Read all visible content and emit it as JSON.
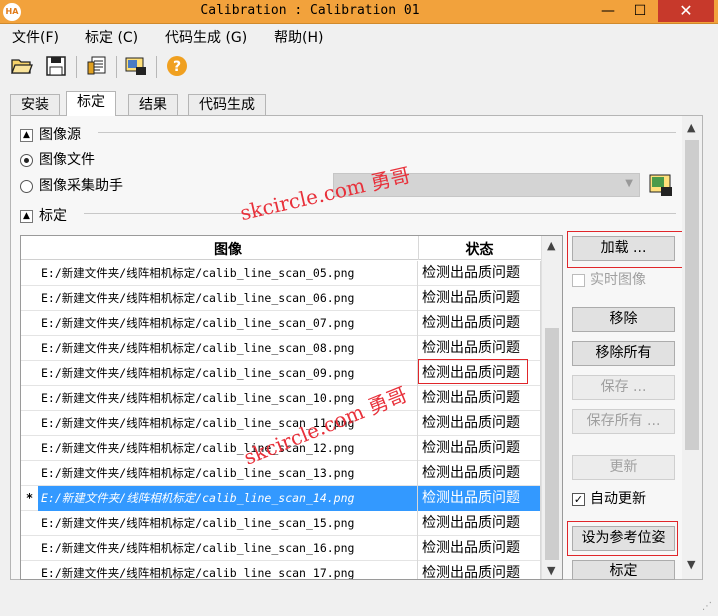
{
  "window": {
    "app_icon_text": "HA",
    "title": "Calibration : Calibration 01",
    "minimize": "—",
    "maximize": "☐",
    "close": "✕"
  },
  "menu": [
    "文件(F)",
    "标定 (C)",
    "代码生成 (G)",
    "帮助(H)"
  ],
  "toolbar": {
    "icons": [
      "open-folder-icon",
      "save-icon",
      "settings-list-icon",
      "camera-capture-icon",
      "help-icon"
    ]
  },
  "tabs": [
    {
      "label": "安装",
      "active": false
    },
    {
      "label": "标定",
      "active": true
    },
    {
      "label": "结果",
      "active": false
    },
    {
      "label": "代码生成",
      "active": false
    }
  ],
  "image_source": {
    "header": "图像源",
    "option_file": "图像文件",
    "option_assistant": "图像采集助手",
    "selected": "图像文件",
    "assistant_combo_value": ""
  },
  "calibration": {
    "header": "标定",
    "columns": [
      "图像",
      "状态"
    ],
    "rows": [
      {
        "marker": "",
        "file": "E:/新建文件夹/线阵相机标定/calib_line_scan_05.png",
        "status": "检测出品质问题"
      },
      {
        "marker": "",
        "file": "E:/新建文件夹/线阵相机标定/calib_line_scan_06.png",
        "status": "检测出品质问题"
      },
      {
        "marker": "",
        "file": "E:/新建文件夹/线阵相机标定/calib_line_scan_07.png",
        "status": "检测出品质问题"
      },
      {
        "marker": "",
        "file": "E:/新建文件夹/线阵相机标定/calib_line_scan_08.png",
        "status": "检测出品质问题"
      },
      {
        "marker": "",
        "file": "E:/新建文件夹/线阵相机标定/calib_line_scan_09.png",
        "status": "检测出品质问题"
      },
      {
        "marker": "",
        "file": "E:/新建文件夹/线阵相机标定/calib_line_scan_10.png",
        "status": "检测出品质问题"
      },
      {
        "marker": "",
        "file": "E:/新建文件夹/线阵相机标定/calib_line_scan_11.png",
        "status": "检测出品质问题"
      },
      {
        "marker": "",
        "file": "E:/新建文件夹/线阵相机标定/calib_line_scan_12.png",
        "status": "检测出品质问题"
      },
      {
        "marker": "",
        "file": "E:/新建文件夹/线阵相机标定/calib_line_scan_13.png",
        "status": "检测出品质问题"
      },
      {
        "marker": "*",
        "file": "E:/新建文件夹/线阵相机标定/calib_line_scan_14.png",
        "status": "检测出品质问题"
      },
      {
        "marker": "",
        "file": "E:/新建文件夹/线阵相机标定/calib_line_scan_15.png",
        "status": "检测出品质问题"
      },
      {
        "marker": "",
        "file": "E:/新建文件夹/线阵相机标定/calib_line_scan_16.png",
        "status": "检测出品质问题"
      },
      {
        "marker": "",
        "file": "E:/新建文件夹/线阵相机标定/calib_line_scan_17.png",
        "status": "检测出品质问题"
      }
    ],
    "selected_row": 9
  },
  "buttons": {
    "load": "加载 ...",
    "live_image": "实时图像",
    "remove": "移除",
    "remove_all": "移除所有",
    "save": "保存 ...",
    "save_all": "保存所有 ...",
    "refresh": "更新",
    "auto_refresh": "自动更新",
    "set_reference_pose": "设为参考位姿",
    "calibrate": "标定"
  },
  "watermarks": [
    "skcircle.com 勇哥",
    "skcircle.com 勇哥"
  ],
  "colors": {
    "titlebar": "#f2a23c",
    "selection": "#3399ff",
    "highlight_box": "#e0262a",
    "close_button": "#c7392b"
  }
}
